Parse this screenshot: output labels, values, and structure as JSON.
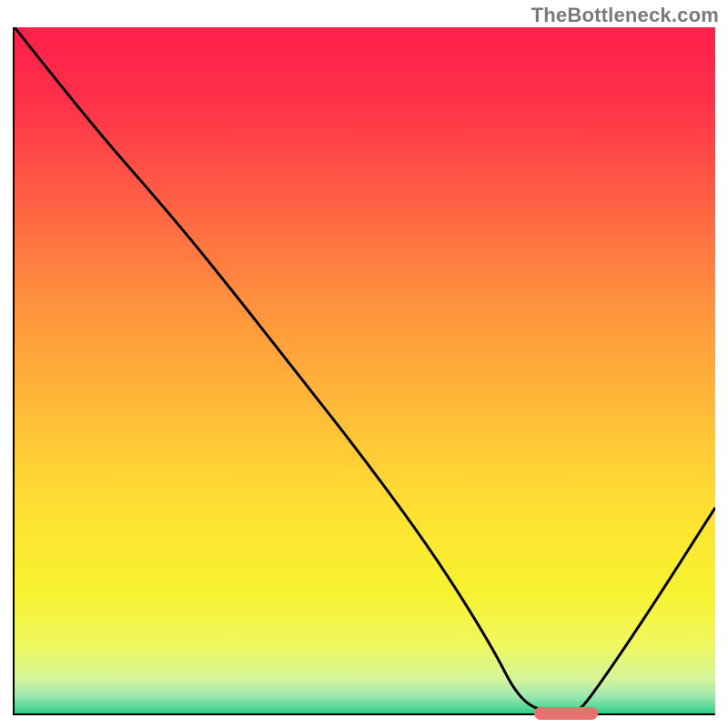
{
  "watermark": "TheBottleneck.com",
  "gradient": {
    "stops": [
      {
        "offset": 0.0,
        "color": "#ff1f4a"
      },
      {
        "offset": 0.1,
        "color": "#ff2f4a"
      },
      {
        "offset": 0.22,
        "color": "#ff5545"
      },
      {
        "offset": 0.4,
        "color": "#ff913e"
      },
      {
        "offset": 0.55,
        "color": "#ffb938"
      },
      {
        "offset": 0.7,
        "color": "#ffe033"
      },
      {
        "offset": 0.82,
        "color": "#f7f22f"
      },
      {
        "offset": 0.9,
        "color": "#f0f85e"
      },
      {
        "offset": 0.95,
        "color": "#d6f49a"
      },
      {
        "offset": 0.975,
        "color": "#9de8b0"
      },
      {
        "offset": 1.0,
        "color": "#2ecf86"
      }
    ]
  },
  "chart_data": {
    "type": "line",
    "title": "",
    "xlabel": "",
    "ylabel": "",
    "xlim": [
      0,
      100
    ],
    "ylim": [
      0,
      100
    ],
    "series": [
      {
        "name": "curve",
        "x": [
          0,
          10,
          22,
          30,
          40,
          50,
          60,
          68,
          72,
          76,
          80,
          82,
          90,
          100
        ],
        "y": [
          100,
          87,
          73,
          63,
          50,
          37,
          23,
          10,
          2,
          0,
          0,
          2,
          14,
          30
        ]
      }
    ],
    "optimal_range_x": [
      74,
      83
    ],
    "optimal_y": 0
  },
  "colors": {
    "curve": "#000000",
    "marker": "#e8716e",
    "axis": "#000000"
  }
}
